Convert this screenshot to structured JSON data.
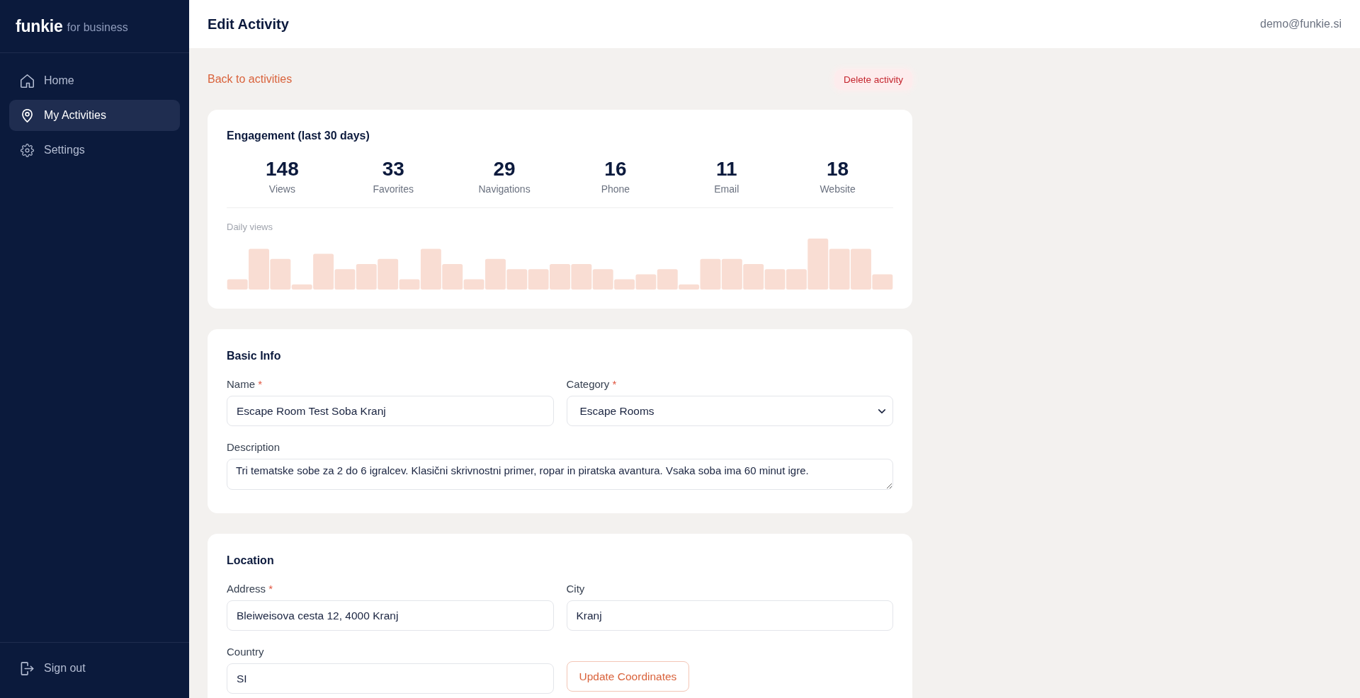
{
  "sidebar": {
    "logo": {
      "brand": "funkie",
      "tagline": "for business"
    },
    "nav_items": [
      {
        "label": "Home",
        "selected": false
      },
      {
        "label": "My Activities",
        "selected": true
      },
      {
        "label": "Settings",
        "selected": false
      }
    ],
    "sign_out": {
      "label": "Sign out"
    }
  },
  "header": {
    "title": "Edit Activity",
    "user_email": "demo@funkie.si"
  },
  "actions": {
    "back_link": "Back to activities",
    "delete_button": "Delete activity"
  },
  "engagement": {
    "title": "Engagement (last 30 days)",
    "stats": [
      {
        "value": "148",
        "label": "Views"
      },
      {
        "value": "33",
        "label": "Favorites"
      },
      {
        "value": "29",
        "label": "Navigations"
      },
      {
        "value": "16",
        "label": "Phone"
      },
      {
        "value": "11",
        "label": "Email"
      },
      {
        "value": "18",
        "label": "Website"
      }
    ],
    "daily_views": {
      "title": "Daily views"
    }
  },
  "sections": [
    {
      "title": "Basic Info",
      "fields": [
        {
          "kind": "input",
          "label": "Name",
          "required_mark": "*",
          "value": "Escape Room Test Soba Kranj"
        },
        {
          "kind": "select",
          "label": "Category",
          "required_mark": "*",
          "value": "Escape Rooms"
        },
        {
          "kind": "textarea",
          "label": "Description",
          "value": "Tri tematske sobe za 2 do 6 igralcev. Klasični skrivnostni primer, ropar in piratska avantura. Vsaka soba ima 60 minut igre."
        }
      ]
    },
    {
      "title": "Location",
      "fields": [
        {
          "kind": "input",
          "label": "Address",
          "required_mark": "*",
          "value": "Bleiweisova cesta 12, 4000 Kranj"
        },
        {
          "kind": "input",
          "label": "City",
          "value": "Kranj"
        },
        {
          "kind": "input",
          "label": "Country",
          "value": "SI"
        },
        {
          "kind": "button",
          "label": "Update Coordinates"
        }
      ]
    }
  ]
}
